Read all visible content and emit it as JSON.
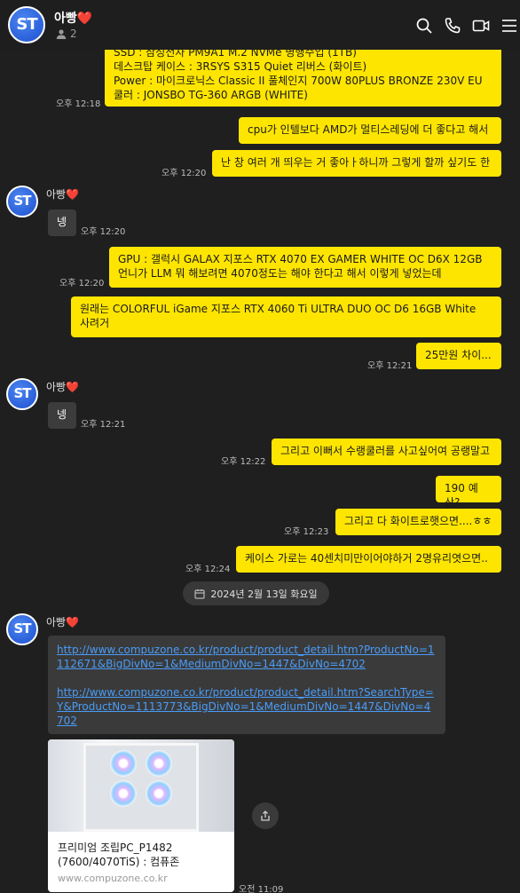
{
  "header": {
    "title": "아빵❤️",
    "member_count": "2",
    "avatar_text": "ST"
  },
  "messages": {
    "m1": {
      "text": "SSD : 삼성전자 PM9A1 M.2 NVMe 병행수입 (1TB)\n데스크탑 케이스 : 3RSYS S315 Quiet 리버스 (화이트)\nPower : 마이크로닉스 Classic II 풀체인지 700W 80PLUS BRONZE 230V EU\n쿨러 : JONSBO TG-360 ARGB (WHITE)",
      "time": "오후 12:18"
    },
    "m2": {
      "text": "cpu가 인텔보다 AMD가 멀티스레딩에 더 좋다고 해서"
    },
    "m3": {
      "text": "난 창 여러 개 띄우는 거 좋아ㅏ하니까 그렇게 할까 싶기도 한",
      "time": "오후 12:20"
    },
    "s1": {
      "sender": "아빵❤️",
      "text": "넹",
      "time": "오후 12:20"
    },
    "m4": {
      "text": "GPU : 갤럭시 GALAX 지포스 RTX 4070 EX GAMER WHITE OC D6X 12GB\n언니가 LLM 뭐 해보려면 4070정도는 해야 한다고 해서 이렇게 넣었는데",
      "time": "오후 12:20"
    },
    "m5": {
      "text": "원래는 COLORFUL iGame 지포스 RTX 4060 Ti ULTRA DUO OC D6 16GB White\n사려거"
    },
    "m6": {
      "text": "25만원 차이...",
      "time": "오후 12:21"
    },
    "s2": {
      "sender": "아빵❤️",
      "text": "넹",
      "time": "오후 12:21"
    },
    "m7": {
      "text": "그리고 이뻐서 수랭쿨러를 사고싶어여 공랭말고",
      "time": "오후 12:22"
    },
    "m8": {
      "text": "190 예산?"
    },
    "m9": {
      "text": "그리고 다 화이트로햇으면....ㅎㅎ",
      "time": "오후 12:23"
    },
    "m10": {
      "text": "케이스 가로는 40센치미만이어야하거 2명유리엿으면..",
      "time": "오후 12:24"
    },
    "date_divider": "2024년 2월 13일 화요일",
    "s3": {
      "sender": "아빵❤️",
      "link1": "http://www.compuzone.co.kr/product/product_detail.htm?ProductNo=1112671&BigDivNo=1&MediumDivNo=1447&DivNo=4702",
      "link2": "http://www.compuzone.co.kr/product/product_detail.htm?SearchType=Y&ProductNo=1113773&BigDivNo=1&MediumDivNo=1447&DivNo=4702",
      "card_title": "프리미엄 조립PC_P1482\n(7600/4070TiS) : 컴퓨존",
      "card_domain": "www.compuzone.co.kr",
      "time": "오전 11:09"
    }
  },
  "icons": [
    "people-icon",
    "search-icon",
    "phone-icon",
    "video-icon",
    "menu-icon",
    "calendar-icon",
    "share-icon"
  ],
  "colors": {
    "my_bubble": "#fee500",
    "their_bubble": "#3c3c3c",
    "background": "#1f1f1f",
    "link": "#4a9cf7",
    "avatar": "#2d63e0"
  }
}
